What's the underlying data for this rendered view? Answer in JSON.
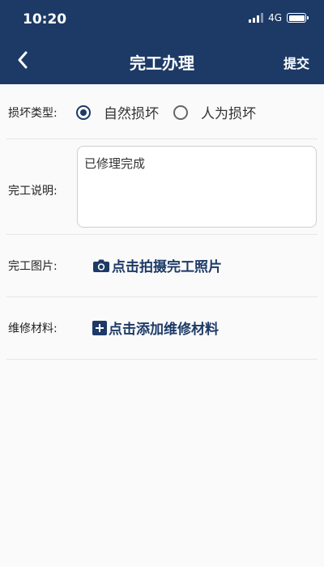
{
  "status_bar": {
    "time": "10:20",
    "network": "4G",
    "battery_level": 1.0
  },
  "nav": {
    "title": "完工办理",
    "submit_label": "提交"
  },
  "form": {
    "damage_type": {
      "label": "损坏类型:",
      "options": [
        {
          "label": "自然损坏",
          "checked": true
        },
        {
          "label": "人为损坏",
          "checked": false
        }
      ]
    },
    "description": {
      "label": "完工说明:",
      "value": "已修理完成"
    },
    "photo": {
      "label": "完工图片:",
      "action_label": "点击拍摄完工照片"
    },
    "material": {
      "label": "维修材料:",
      "action_label": "点击添加维修材料"
    }
  },
  "colors": {
    "primary": "#1d3a66",
    "background": "#fafafa"
  },
  "icons": {
    "back": "chevron-left-icon",
    "camera": "camera-icon",
    "add": "plus-square-icon"
  }
}
